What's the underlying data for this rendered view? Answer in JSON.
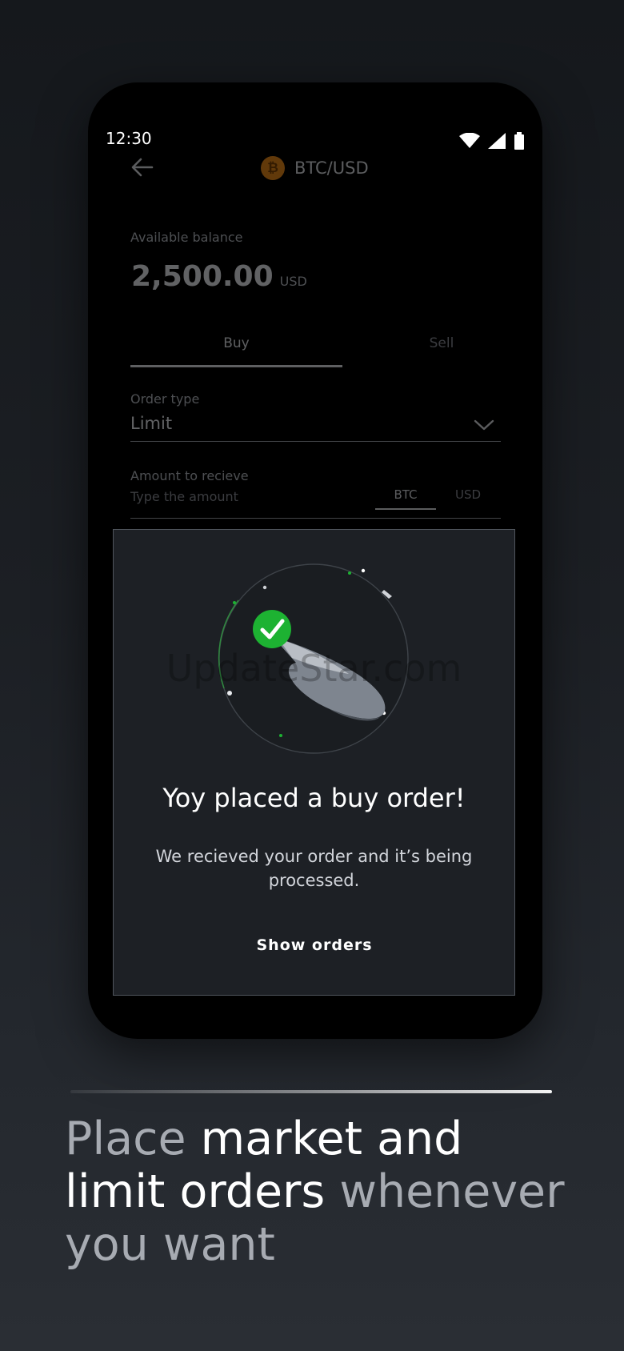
{
  "status_bar": {
    "time": "12:30"
  },
  "app_bar": {
    "pair": "BTC/USD",
    "coin_symbol": "₿"
  },
  "balance": {
    "label": "Available balance",
    "value": "2,500.00",
    "currency": "USD"
  },
  "tabs": [
    {
      "label": "Buy",
      "selected": true
    },
    {
      "label": "Sell",
      "selected": false
    }
  ],
  "order_type": {
    "label": "Order type",
    "value": "Limit"
  },
  "amount": {
    "label": "Amount to recieve",
    "placeholder": "Type the amount",
    "currencies": [
      "BTC",
      "USD"
    ],
    "selected_currency": "BTC"
  },
  "dialog": {
    "title": "Yoy placed a buy order!",
    "body": "We recieved your order and it’s being processed.",
    "button": "Show orders",
    "watermark": "UpdateStar.com"
  },
  "headline": {
    "part1": "Place ",
    "part2": "market and",
    "part3": "limit orders",
    "part4": " whenever",
    "part5": "you want"
  },
  "colors": {
    "accent_green": "#1db232",
    "coin_orange": "#e8891a",
    "dialog_bg": "#1d2025",
    "page_bg": "#15181c"
  }
}
